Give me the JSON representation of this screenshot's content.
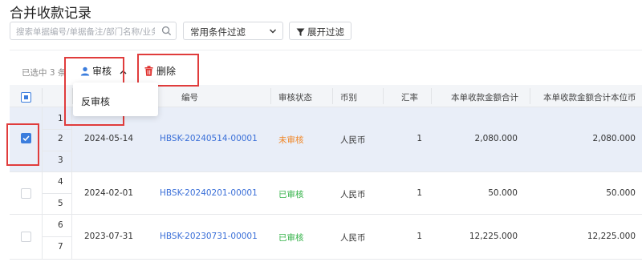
{
  "page": {
    "title": "合并收款记录"
  },
  "search": {
    "placeholder": "搜索单据编号/单据备注/部门名称/业务"
  },
  "filter": {
    "selected": "常用条件过滤"
  },
  "expand_filter": {
    "label": "展开过滤"
  },
  "toolbar": {
    "selected_count": "已选中 3 条",
    "review_label": "审核",
    "delete_label": "删除"
  },
  "dropdown": {
    "items": [
      {
        "label": "反审核"
      }
    ]
  },
  "table": {
    "columns": [
      "",
      "",
      "",
      "单据编号",
      "审核状态",
      "币别",
      "汇率",
      "本单收款金额合计",
      "本单收款金额合计本位币"
    ],
    "header_number_partial": "编号",
    "row_numbers": [
      "1",
      "2",
      "3",
      "4",
      "5",
      "6",
      "7"
    ],
    "rows": [
      {
        "date": "2024-05-14",
        "code": "HBSK-20240514-00001",
        "status": "未审核",
        "currency": "人民币",
        "rate": "1",
        "amount": "2,080.000",
        "amount_base": "2,080.000",
        "checked": true
      },
      {
        "date": "2024-02-01",
        "code": "HBSK-20240201-00001",
        "status": "已审核",
        "currency": "人民币",
        "rate": "1",
        "amount": "50.000",
        "amount_base": "50.000",
        "checked": false
      },
      {
        "date": "2023-07-31",
        "code": "HBSK-20230731-00001",
        "status": "已审核",
        "currency": "人民币",
        "rate": "1",
        "amount": "12,225.000",
        "amount_base": "12,225.000",
        "checked": false
      }
    ]
  },
  "colors": {
    "accent": "#3b7ddd",
    "link": "#3a6fd8",
    "pending": "#f0882a",
    "approved": "#36b34a",
    "highlight": "#e03c3c",
    "delete_icon": "#e0322f"
  }
}
